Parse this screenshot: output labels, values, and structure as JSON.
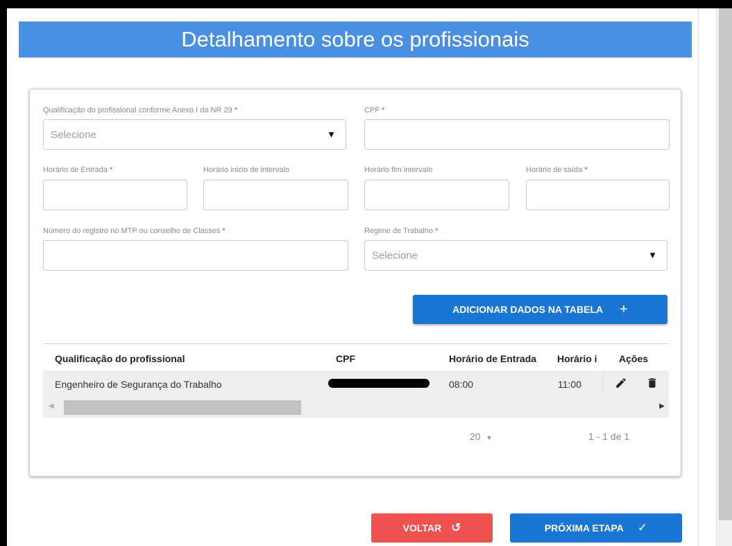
{
  "page": {
    "title": "Detalhamento sobre os profissionais"
  },
  "colors": {
    "banner": "#4a90e2",
    "primary_button": "#1976d2",
    "back_button": "#ef5350",
    "required_mark": "#e53935"
  },
  "form": {
    "qualificacao": {
      "label": "Qualificação do profissional conforme Anexo I da NR 29",
      "required": "*",
      "placeholder": "Selecione"
    },
    "cpf": {
      "label": "CPF",
      "required": "*",
      "value": ""
    },
    "horario_entrada": {
      "label": "Horário de Entrada",
      "required": "*",
      "value": ""
    },
    "horario_inicio_intervalo": {
      "label": "Horário inicio de intervalo",
      "value": ""
    },
    "horario_fim_intervalo": {
      "label": "Horário fim intervalo",
      "value": ""
    },
    "horario_saida": {
      "label": "Horário de saída",
      "required": "*",
      "value": ""
    },
    "numero_registro": {
      "label": "Número do registro no MTP ou conselho de Classes",
      "required": "*",
      "value": ""
    },
    "regime_trabalho": {
      "label": "Regime de Trabalho",
      "required": "*",
      "placeholder": "Selecione"
    },
    "add_button_label": "ADICIONAR DADOS NA TABELA",
    "add_button_icon": "plus-icon"
  },
  "table": {
    "columns": [
      "Qualificação do profissional",
      "CPF",
      "Horário de Entrada",
      "Horário i",
      "Ações"
    ],
    "rows": [
      {
        "qualificacao": "Engenheiro de Segurança do Trabalho",
        "cpf": "",
        "horario_entrada": "08:00",
        "horario_inicio": "11:00",
        "actions": [
          "edit-icon",
          "delete-icon"
        ]
      }
    ],
    "pagination": {
      "page_size": "20",
      "range": "1 - 1 de 1"
    }
  },
  "footer": {
    "back_label": "VOLTAR",
    "back_icon": "undo-icon",
    "next_label": "PRÓXIMA ETAPA",
    "next_icon": "check-icon"
  }
}
